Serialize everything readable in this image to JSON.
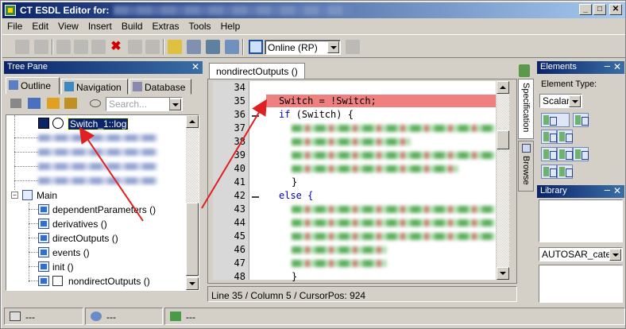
{
  "window": {
    "title": "CT ESDL Editor for:",
    "buttons": {
      "minimize": "_",
      "maximize": "□",
      "close": "✕"
    }
  },
  "menu": [
    "File",
    "Edit",
    "View",
    "Insert",
    "Build",
    "Extras",
    "Tools",
    "Help"
  ],
  "toolbar": {
    "mode_select": "Online (RP)"
  },
  "tree_pane": {
    "title": "Tree Pane",
    "tabs": [
      "Outline",
      "Navigation",
      "Database"
    ],
    "search_placeholder": "Search...",
    "selected_item": "Switch_1::log",
    "main_label": "Main",
    "functions": [
      "dependentParameters ()",
      "derivatives ()",
      "directOutputs ()",
      "events ()",
      "init ()",
      "nondirectOutputs ()"
    ]
  },
  "editor": {
    "tab_label": "nondirectOutputs ()",
    "lines": [
      {
        "no": "34",
        "text": ""
      },
      {
        "no": "35",
        "text": "Switch = !Switch;"
      },
      {
        "no": "36",
        "text": "if (Switch) {"
      },
      {
        "no": "37",
        "text": ""
      },
      {
        "no": "38",
        "text": ""
      },
      {
        "no": "39",
        "text": ""
      },
      {
        "no": "40",
        "text": ""
      },
      {
        "no": "41",
        "text": "}"
      },
      {
        "no": "42",
        "text": "else {"
      },
      {
        "no": "43",
        "text": ""
      },
      {
        "no": "44",
        "text": ""
      },
      {
        "no": "45",
        "text": ""
      },
      {
        "no": "46",
        "text": ""
      },
      {
        "no": "47",
        "text": ""
      },
      {
        "no": "48",
        "text": "}"
      }
    ],
    "status": "Line 35 / Column 5 / CursorPos: 924"
  },
  "side_tabs": [
    "Specification",
    "Browse"
  ],
  "elements_panel": {
    "title": "Elements",
    "type_label": "Element Type:",
    "type_value": "Scalar"
  },
  "library_panel": {
    "title": "Library",
    "category_value": "AUTOSAR_categc"
  },
  "statusbar": [
    "---",
    "---",
    "---"
  ],
  "colors": {
    "title_bar": "#0a246a",
    "highlight_line": "#f08080",
    "annotation_arrow": "#e02020"
  }
}
